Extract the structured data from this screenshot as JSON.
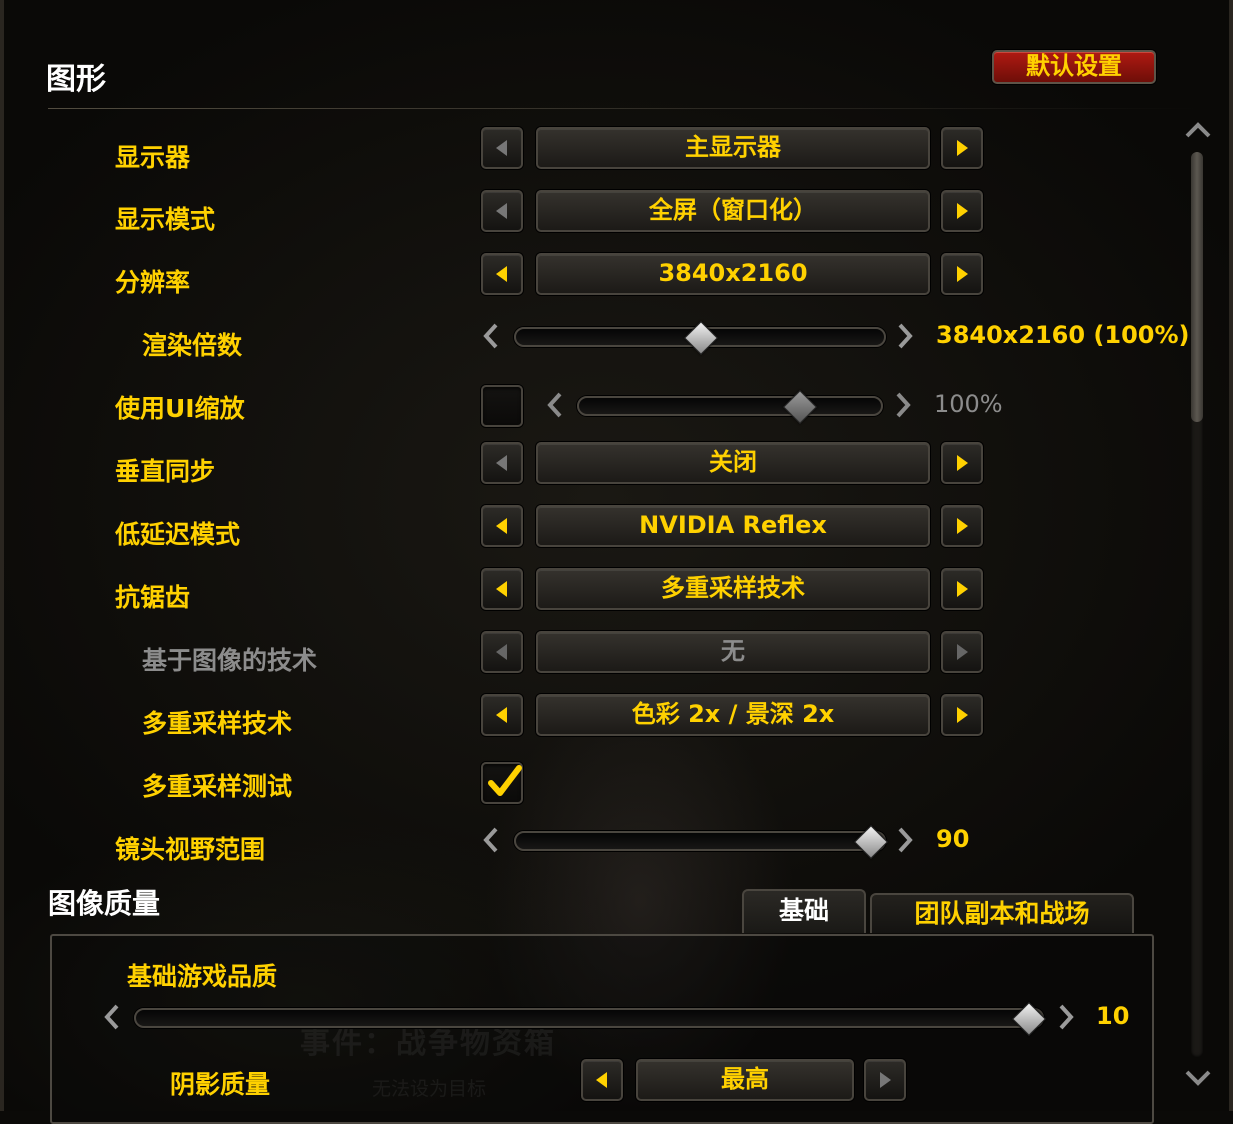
{
  "header": {
    "title": "图形",
    "defaults_button": "默认设置"
  },
  "display": {
    "monitor": {
      "label": "显示器",
      "value": "主显示器"
    },
    "display_mode": {
      "label": "显示模式",
      "value": "全屏（窗口化）"
    },
    "resolution": {
      "label": "分辨率",
      "value": "3840x2160"
    },
    "render_scale": {
      "label": "渲染倍数",
      "value_text": "3840x2160 (100%)",
      "level": 0.5
    },
    "ui_scale": {
      "label": "使用UI缩放",
      "checked": false,
      "value_text": "100%",
      "level": 0.75
    },
    "vsync": {
      "label": "垂直同步",
      "value": "关闭"
    },
    "low_latency": {
      "label": "低延迟模式",
      "value": "NVIDIA Reflex"
    },
    "anti_aliasing": {
      "label": "抗锯齿",
      "value": "多重采样技术"
    },
    "image_based": {
      "label": "基于图像的技术",
      "value": "无",
      "disabled": true
    },
    "multisample": {
      "label": "多重采样技术",
      "value": "色彩 2x / 景深 2x"
    },
    "multisample_test": {
      "label": "多重采样测试",
      "checked": true
    },
    "fov": {
      "label": "镜头视野范围",
      "value_text": "90",
      "level": 1.0
    }
  },
  "quality": {
    "title": "图像质量",
    "tabs": [
      "基础",
      "团队副本和战场"
    ],
    "active_tab": "基础",
    "base_quality": {
      "label": "基础游戏品质",
      "value_text": "10",
      "level": 1.0
    },
    "shadow": {
      "label": "阴影质量",
      "value": "最高"
    }
  },
  "background": {
    "text1": "事件：战争物资箱",
    "text2": "无法设为目标"
  },
  "colors": {
    "label_gold": "#ffd100",
    "disabled_gray": "#8c8c8c",
    "default_button_red": "#b01a12"
  },
  "icons": {
    "left_arrow": "left-arrow-icon",
    "right_arrow": "right-arrow-icon",
    "checkmark": "checkmark-icon",
    "scroll_up": "chevron-up-icon",
    "scroll_down": "chevron-down-icon"
  }
}
